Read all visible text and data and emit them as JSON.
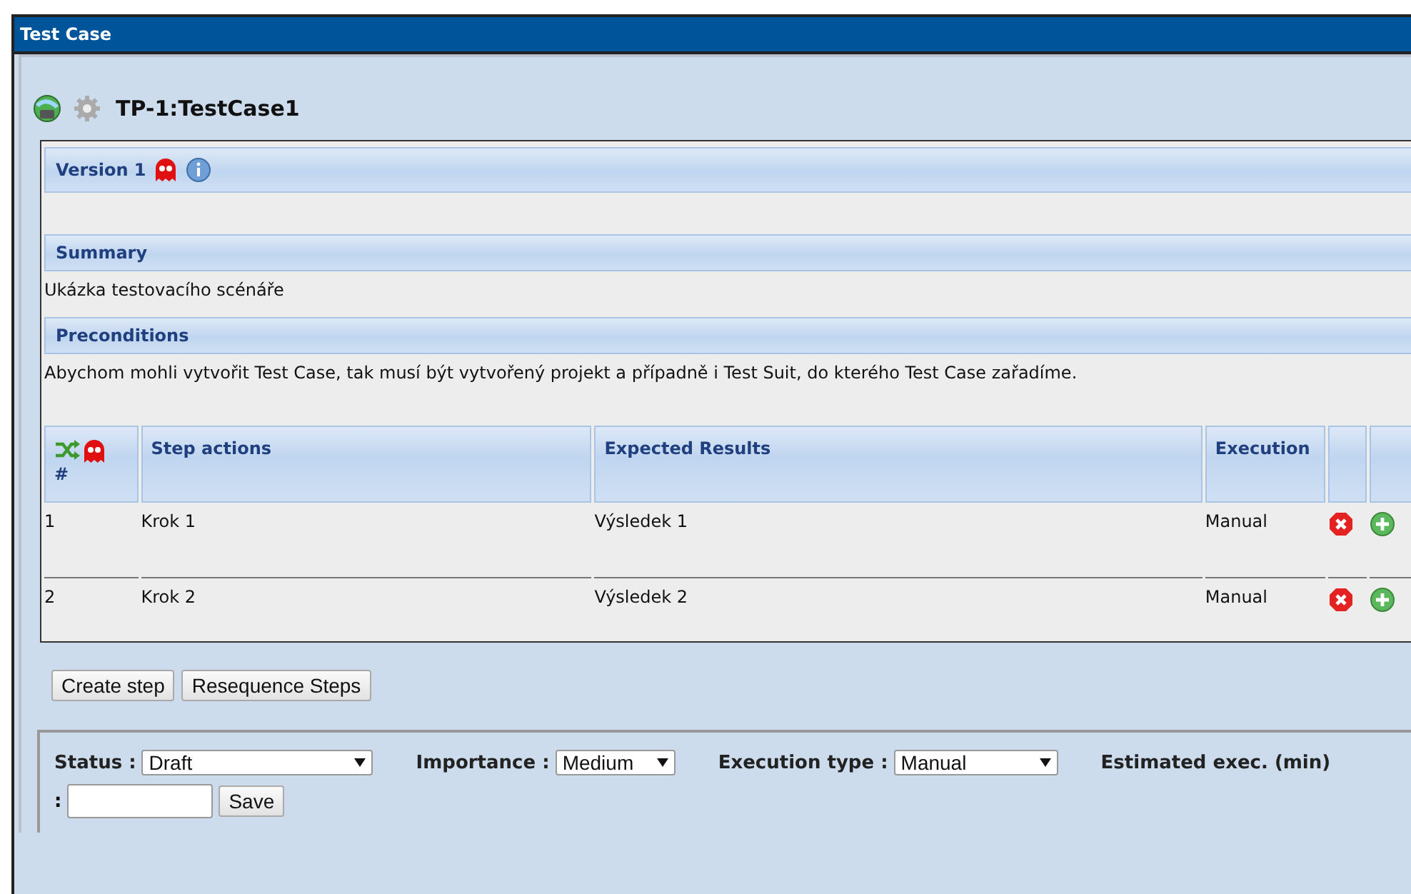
{
  "window": {
    "title": "Test Case"
  },
  "test_case": {
    "title": "TP-1:TestCase1"
  },
  "version": {
    "label": "Version 1"
  },
  "summary": {
    "title": "Summary",
    "text": "Ukázka testovacího scénáře"
  },
  "preconditions": {
    "title": "Preconditions",
    "text": "Abychom mohli vytvořit Test Case, tak musí být vytvořený projekt a případně i Test Suit, do kterého Test Case zařadíme."
  },
  "steps": {
    "columns": [
      "#",
      "Step actions",
      "Expected Results",
      "Execution"
    ],
    "rows": [
      {
        "number": "1",
        "action": "Krok 1",
        "expected": "Výsledek 1",
        "execution": "Manual"
      },
      {
        "number": "2",
        "action": "Krok 2",
        "expected": "Výsledek 2",
        "execution": "Manual"
      }
    ]
  },
  "buttons": [
    "Create step",
    "Resequence Steps"
  ],
  "fields": [
    {
      "kind": "select",
      "label": "Status :",
      "value": "Draft"
    },
    {
      "kind": "select",
      "label": "Importance :",
      "value": "Medium"
    },
    {
      "kind": "select",
      "label": "Execution type :",
      "value": "Manual"
    },
    {
      "kind": "input",
      "label": "Estimated exec. (min)",
      "separator": ":"
    }
  ],
  "save_button": "Save"
}
